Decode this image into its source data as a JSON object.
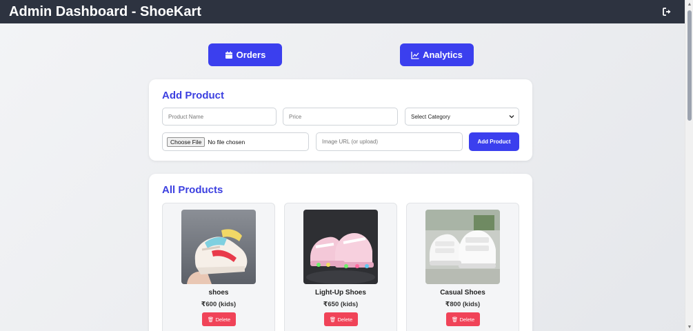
{
  "header": {
    "title": "Admin Dashboard - ShoeKart",
    "logout_icon": "logout-icon"
  },
  "nav": {
    "orders_label": "Orders",
    "orders_icon": "calendar-icon",
    "analytics_label": "Analytics",
    "analytics_icon": "line-chart-icon"
  },
  "add_product": {
    "title": "Add Product",
    "name_placeholder": "Product Name",
    "price_placeholder": "Price",
    "category_selected": "Select Category",
    "file_button": "Choose File",
    "file_status": "No file chosen",
    "image_url_placeholder": "Image URL (or upload)",
    "submit_label": "Add Product"
  },
  "products": {
    "title": "All Products",
    "items": [
      {
        "name": "shoes",
        "price": "₹600 (kids)",
        "delete_label": "🗑 Delete"
      },
      {
        "name": "Light-Up Shoes",
        "price": "₹650 (kids)",
        "delete_label": "🗑 Delete"
      },
      {
        "name": "Casual Shoes",
        "price": "₹800 (kids)",
        "delete_label": "🗑 Delete"
      }
    ]
  },
  "colors": {
    "header_bg": "#2d3340",
    "accent": "#3b3fee",
    "delete": "#f04358"
  }
}
